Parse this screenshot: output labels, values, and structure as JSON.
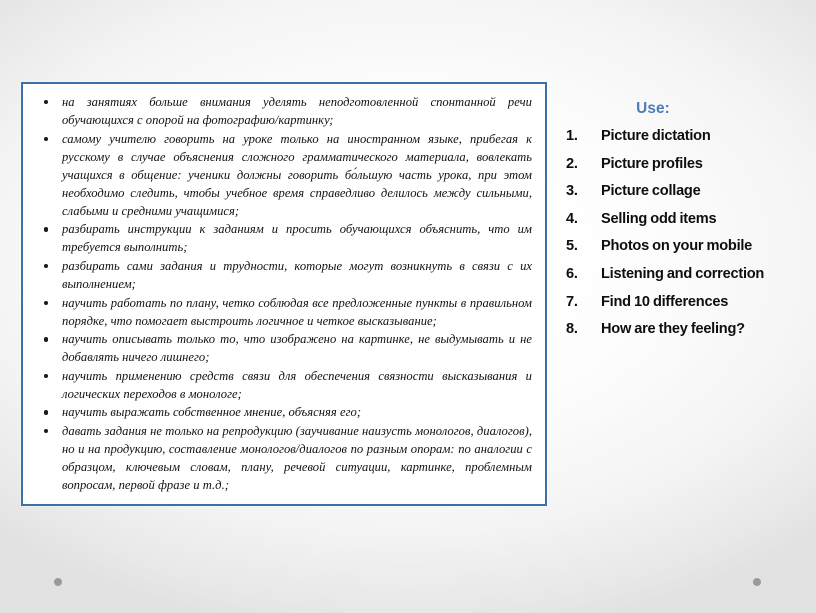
{
  "slide": {
    "background_color": "#f2f2f2",
    "accent_color": "#4a7ebb",
    "box_border_color": "#3d6fa8"
  },
  "content_box": {
    "bullets": [
      "на занятиях больше внимания уделять неподготовленной спонтанной речи обучающихся с опорой на фотографию/картинку;",
      "самому учителю говорить на уроке только на иностранном языке, прибегая к русскому в случае объяснения сложного грамматического материала, вовлекать учащихся в общение: ученики должны говорить бо́льшую часть урока, при этом необходимо следить, чтобы учебное время справедливо делилось между сильными, слабыми и средними учащимися;",
      "разбирать инструкции к заданиям и просить обучающихся объяснить, что им требуется выполнить;",
      "разбирать сами задания и трудности, которые могут возникнуть в связи с их выполнением;",
      "научить работать по плану, четко соблюдая все предложенные пункты в правильном порядке, что помогает выстроить логичное и четкое высказывание;",
      "научить описывать только то, что изображено на картинке, не выдумывать и не добавлять ничего лишнего;",
      "научить применению средств связи для обеспечения связности высказывания и логических переходов в монологе;",
      "научить выражать собственное мнение, объясняя его;",
      "давать задания не только на репродукцию (заучивание наизусть монологов, диалогов), но и на продукцию, составление монологов/диалогов по разным опорам: по аналогии с образцом, ключевым словам, плану, речевой ситуации, картинке, проблемным вопросам, первой фразе и т.д.;"
    ]
  },
  "right_column": {
    "heading": "Use:",
    "items": [
      {
        "number": "1.",
        "label": "Picture dictation"
      },
      {
        "number": "2.",
        "label": "Picture profiles"
      },
      {
        "number": "3.",
        "label": "Picture collage"
      },
      {
        "number": "4.",
        "label": "Selling odd items"
      },
      {
        "number": "5.",
        "label": "Photos on your mobile"
      },
      {
        "number": "6.",
        "label": "Listening and correction"
      },
      {
        "number": "7.",
        "label": "Find 10 differences"
      },
      {
        "number": "8.",
        "label": "How are they feeling?"
      }
    ]
  },
  "decorations": {
    "dot_left": "decorative-dot",
    "dot_right": "decorative-dot"
  }
}
